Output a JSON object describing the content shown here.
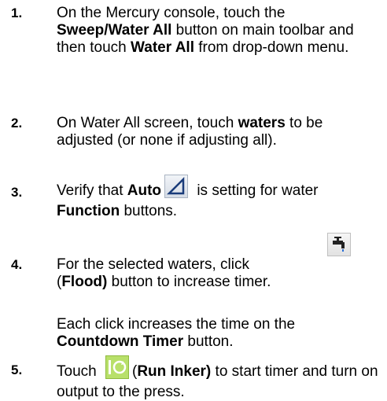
{
  "steps": [
    {
      "number": "1.",
      "parts": [
        "On the Mercury console, touch the ",
        "Sweep/Water All",
        " button on main toolbar and then touch ",
        "Water All",
        " from drop-down menu."
      ]
    },
    {
      "number": "2.",
      "parts": [
        "On Water All screen, touch ",
        "waters",
        " to be adjusted (or none if adjusting all)."
      ]
    },
    {
      "number": "3.",
      "parts": [
        "Verify that ",
        "Auto",
        " is setting for water ",
        "Function",
        " buttons."
      ]
    },
    {
      "number": "4.",
      "parts": [
        "For the selected waters, click",
        "(",
        "Flood)",
        " button to increase timer."
      ]
    },
    {
      "number": "",
      "parts": [
        "Each click increases the time on the ",
        "Countdown Timer",
        " button."
      ]
    },
    {
      "number": "5.",
      "parts": [
        "Touch ",
        "(",
        "Run Inker)",
        " to start timer and turn on output to the press."
      ]
    }
  ],
  "icons": {
    "auto": "auto-triangle-icon",
    "flood": "faucet-flood-icon",
    "run_inker": "run-inker-cycle-icon"
  },
  "colors": {
    "text": "#000000",
    "run_inker_bg": "#b8e06a",
    "auto_icon_stroke": "#1a3c7a"
  }
}
